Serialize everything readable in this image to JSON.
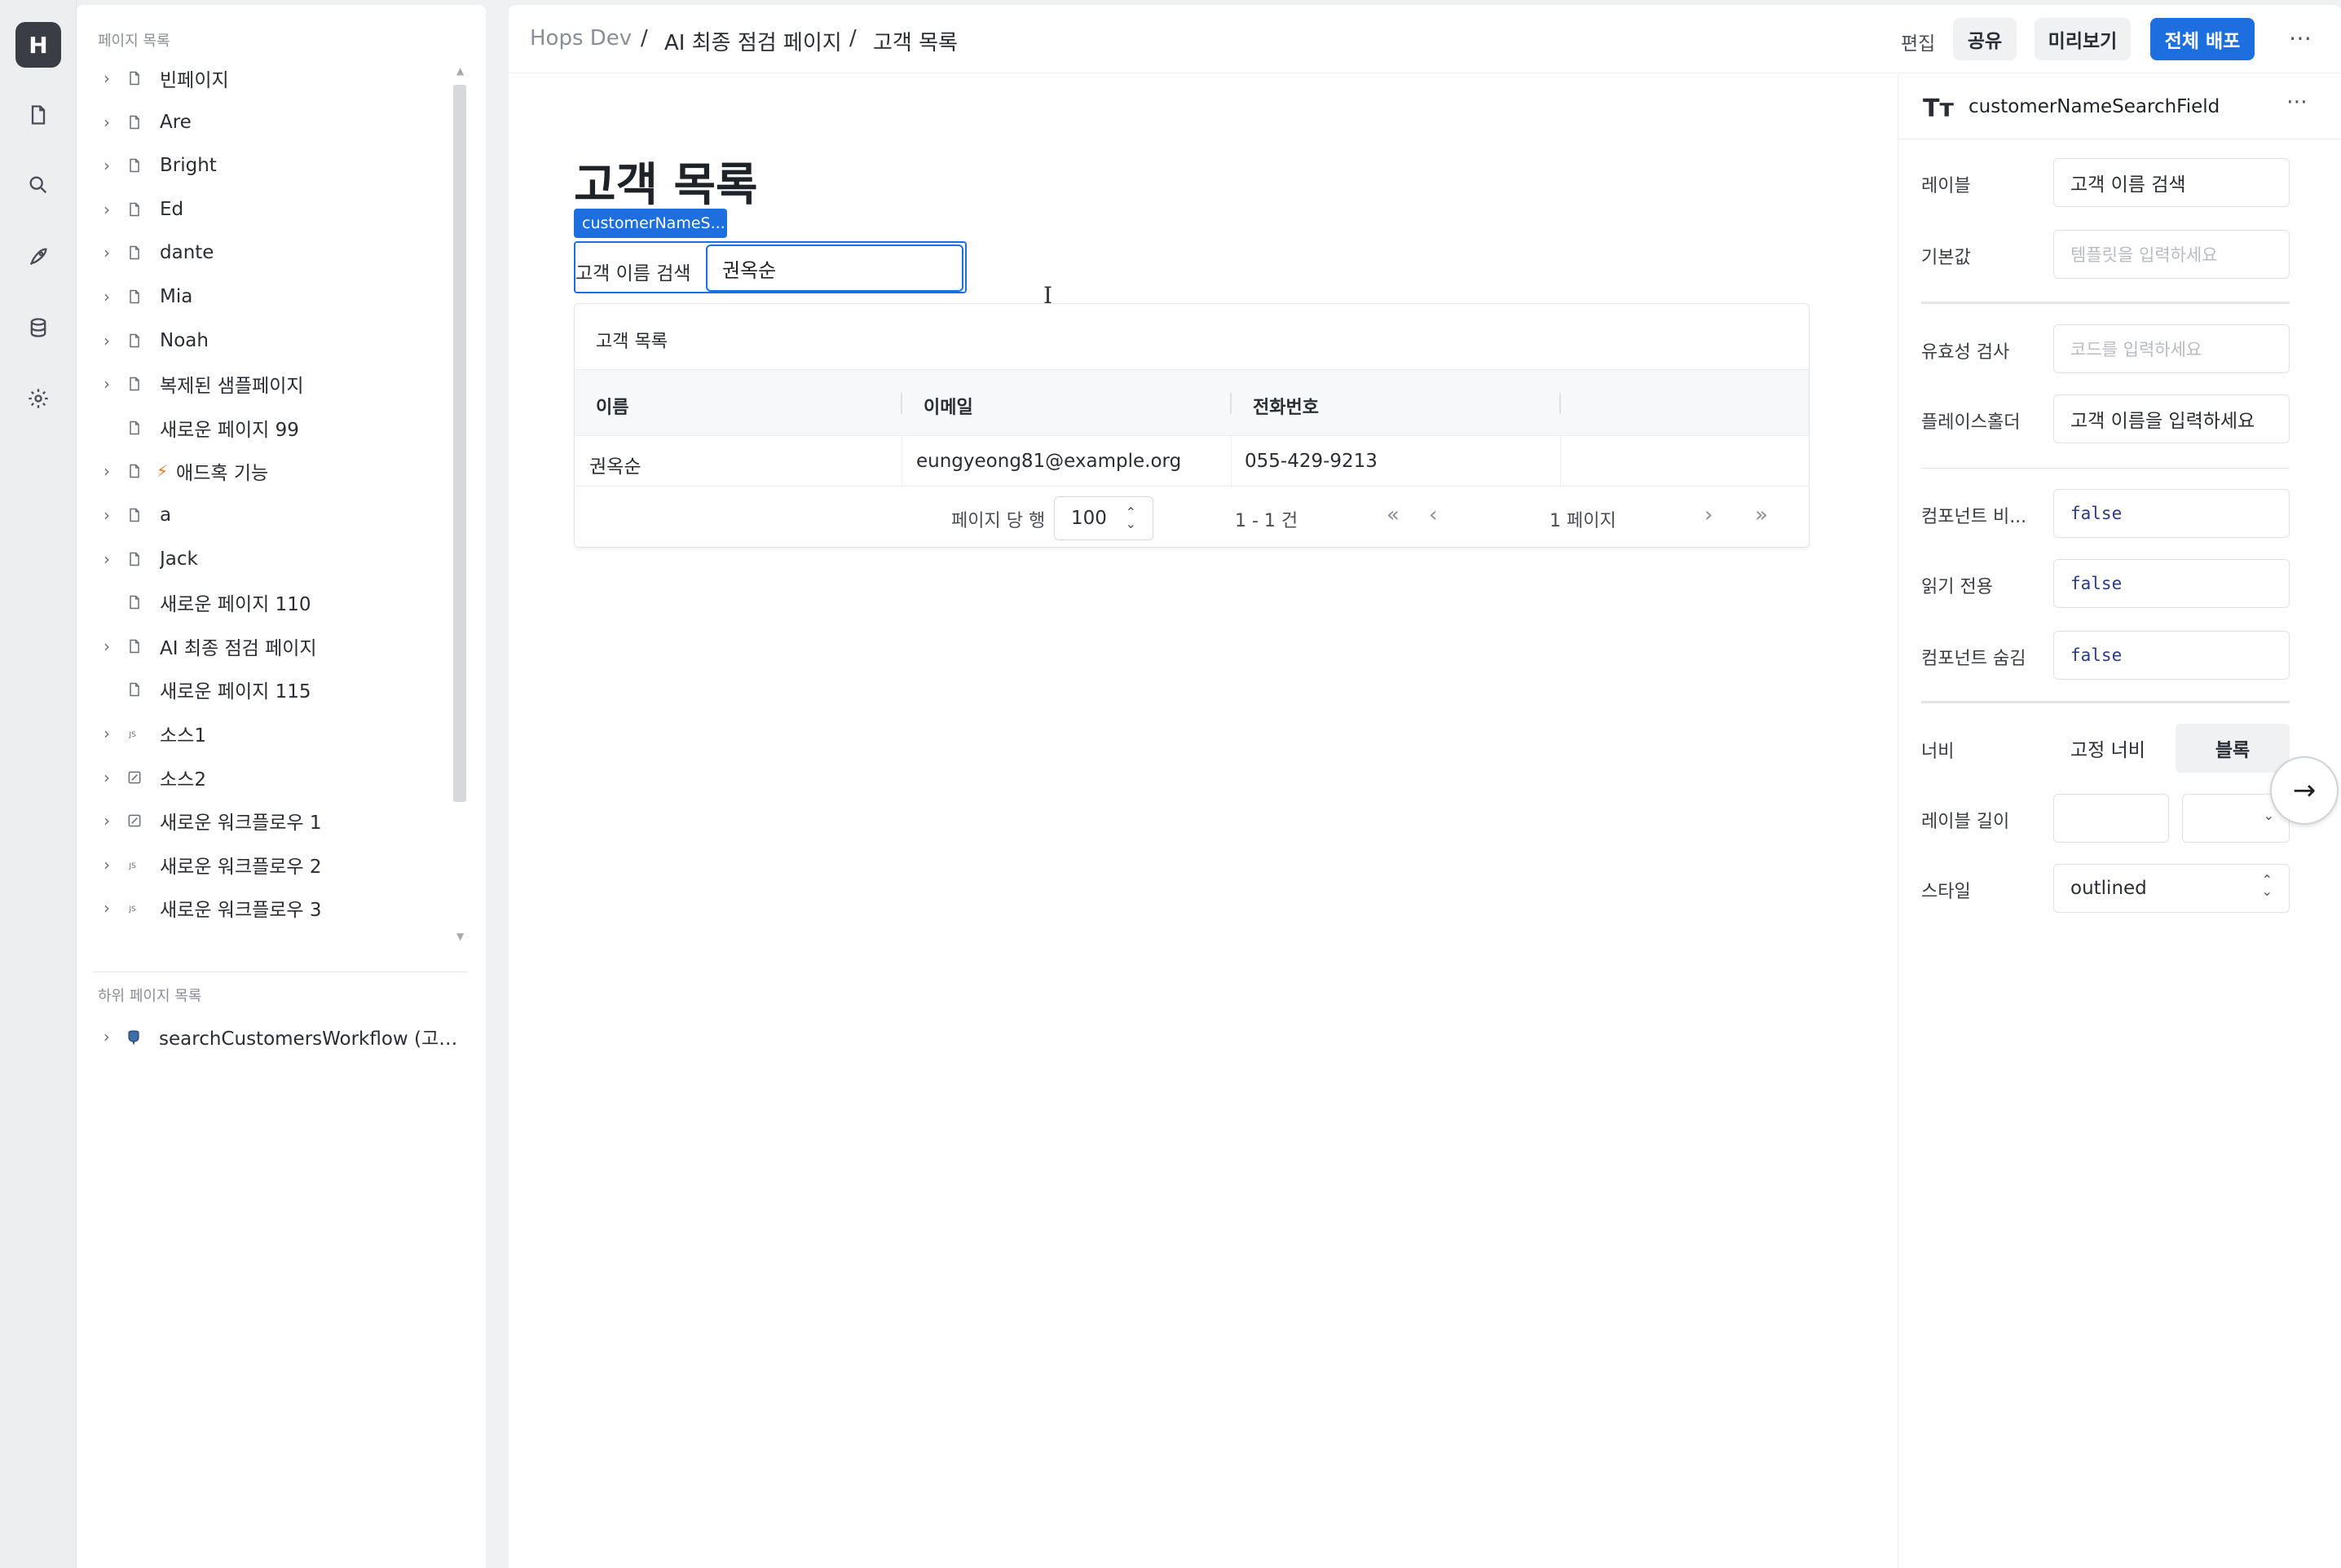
{
  "rail": {
    "logo": "H",
    "items": [
      {
        "icon": "page-icon"
      },
      {
        "icon": "search-icon"
      },
      {
        "icon": "rocket-icon"
      },
      {
        "icon": "database-icon"
      },
      {
        "icon": "gear-icon"
      }
    ]
  },
  "left_panel": {
    "pages_title": "페이지 목록",
    "pages": [
      {
        "label": "빈페이지",
        "icon": "page",
        "chevron": true
      },
      {
        "label": "Are",
        "icon": "page",
        "chevron": true
      },
      {
        "label": "Bright",
        "icon": "page",
        "chevron": true
      },
      {
        "label": "Ed",
        "icon": "page",
        "chevron": true
      },
      {
        "label": "dante",
        "icon": "page",
        "chevron": true
      },
      {
        "label": "Mia",
        "icon": "page",
        "chevron": true
      },
      {
        "label": "Noah",
        "icon": "page",
        "chevron": true
      },
      {
        "label": "복제된 샘플페이지",
        "icon": "page",
        "chevron": true
      },
      {
        "label": "새로운 페이지 99",
        "icon": "page",
        "chevron": false
      },
      {
        "label": "애드혹 기능",
        "icon": "page",
        "chevron": true,
        "badge": "⚡"
      },
      {
        "label": "a",
        "icon": "page",
        "chevron": true
      },
      {
        "label": "Jack",
        "icon": "page",
        "chevron": true
      },
      {
        "label": "새로운 페이지 110",
        "icon": "page",
        "chevron": false
      },
      {
        "label": "AI 최종 점검 페이지",
        "icon": "page",
        "chevron": true
      },
      {
        "label": "새로운 페이지 115",
        "icon": "page",
        "chevron": false
      },
      {
        "label": "소스1",
        "icon": "js",
        "chevron": true
      },
      {
        "label": "소스2",
        "icon": "edit",
        "chevron": true
      },
      {
        "label": "새로운 워크플로우 1",
        "icon": "edit",
        "chevron": true
      },
      {
        "label": "새로운 워크플로우 2",
        "icon": "js",
        "chevron": true
      },
      {
        "label": "새로운 워크플로우 3",
        "icon": "js",
        "chevron": true
      }
    ],
    "subpages_title": "하위 페이지 목록",
    "subpages": [
      {
        "label": "searchCustomersWorkflow (고객 ...",
        "icon": "postgres"
      }
    ]
  },
  "topbar": {
    "breadcrumb": [
      "Hops Dev",
      "AI 최종 점검 페이지",
      "고객 목록"
    ],
    "separator": "/",
    "edit_label": "편집",
    "share_label": "공유",
    "preview_label": "미리보기",
    "deploy_label": "전체 배포",
    "more_label": "⋯"
  },
  "canvas": {
    "page_title": "고객 목록",
    "selected_tag": "customerNameS...",
    "search_label": "고객 이름 검색",
    "search_value": "권옥순",
    "table": {
      "title": "고객 목록",
      "columns": [
        "이름",
        "이메일",
        "전화번호"
      ],
      "rows": [
        [
          "권옥순",
          "eungyeong81@example.org",
          "055-429-9213"
        ]
      ],
      "rows_per_page_label": "페이지 당 행",
      "rows_per_page": "100",
      "range_text": "1 - 1 건",
      "page_text": "1 페이지"
    }
  },
  "props": {
    "component_name": "customerNameSearchField",
    "fields": {
      "label": {
        "name": "레이블",
        "value": "고객 이름 검색"
      },
      "default": {
        "name": "기본값",
        "placeholder": "템플릿을 입력하세요"
      },
      "validation": {
        "name": "유효성 검사",
        "placeholder": "코드를 입력하세요"
      },
      "placeholder": {
        "name": "플레이스홀더",
        "value": "고객 이름을 입력하세요"
      },
      "disabled": {
        "name": "컴포넌트 비...",
        "value": "false"
      },
      "readonly": {
        "name": "읽기 전용",
        "value": "false"
      },
      "hidden": {
        "name": "컴포넌트 숨김",
        "value": "false"
      },
      "width": {
        "name": "너비",
        "options": [
          "고정 너비",
          "블록"
        ],
        "selected": "블록"
      },
      "label_length": {
        "name": "레이블 길이"
      },
      "style": {
        "name": "스타일",
        "value": "outlined"
      }
    }
  },
  "colors": {
    "accent": "#1d6fe0",
    "rail": "#eceef0",
    "logo_bg": "#3a3d44"
  }
}
